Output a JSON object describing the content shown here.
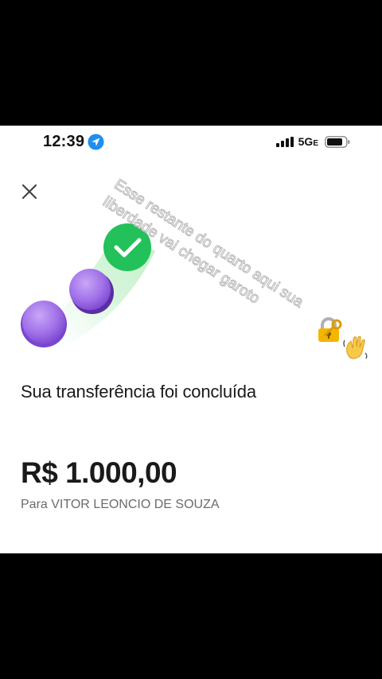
{
  "status_bar": {
    "time": "12:39",
    "network": "5G",
    "network_suffix": "E"
  },
  "header": {
    "close_icon": "close-icon"
  },
  "illustration": {
    "check_color": "#22c55e",
    "coin_color": "#9b6ee0",
    "trail_color": "#c9f2cf"
  },
  "content": {
    "title": "Sua transferência foi concluída",
    "amount": "R$ 1.000,00",
    "recipient": "Para VITOR LEONCIO DE SOUZA"
  },
  "overlay_text": "Esse restante do quarto aqui sua liberdade vai chegar garoto"
}
